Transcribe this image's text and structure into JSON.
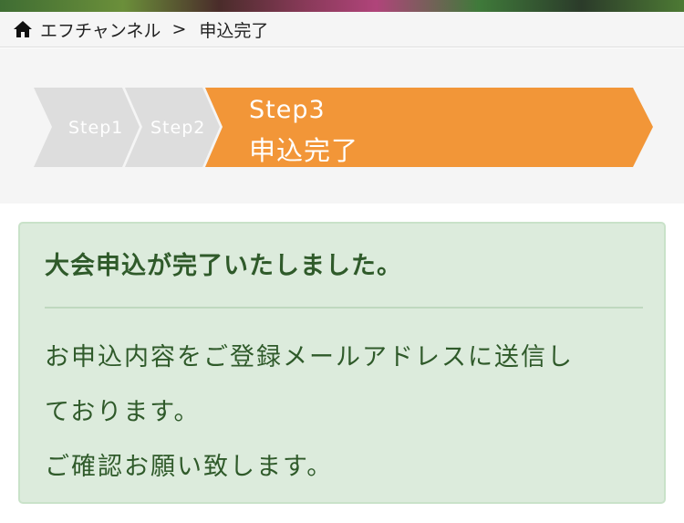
{
  "breadcrumb": {
    "home_icon": "home-icon",
    "site": "エフチャンネル",
    "separator": ">",
    "current": "申込完了"
  },
  "steps": [
    {
      "label": "Step1",
      "state": "done",
      "color": "#dddddd"
    },
    {
      "label": "Step2",
      "state": "done",
      "color": "#dddddd"
    },
    {
      "label": "Step3",
      "sublabel": "申込完了",
      "state": "current",
      "color": "#f29638"
    }
  ],
  "alert": {
    "heading": "大会申込が完了いたしました。",
    "line1": "お申込内容をご登録メールアドレスに送信し",
    "line2": "ております。",
    "line3": "ご確認お願い致します。",
    "background": "#dcebdc",
    "text_color": "#2f5a2a"
  }
}
